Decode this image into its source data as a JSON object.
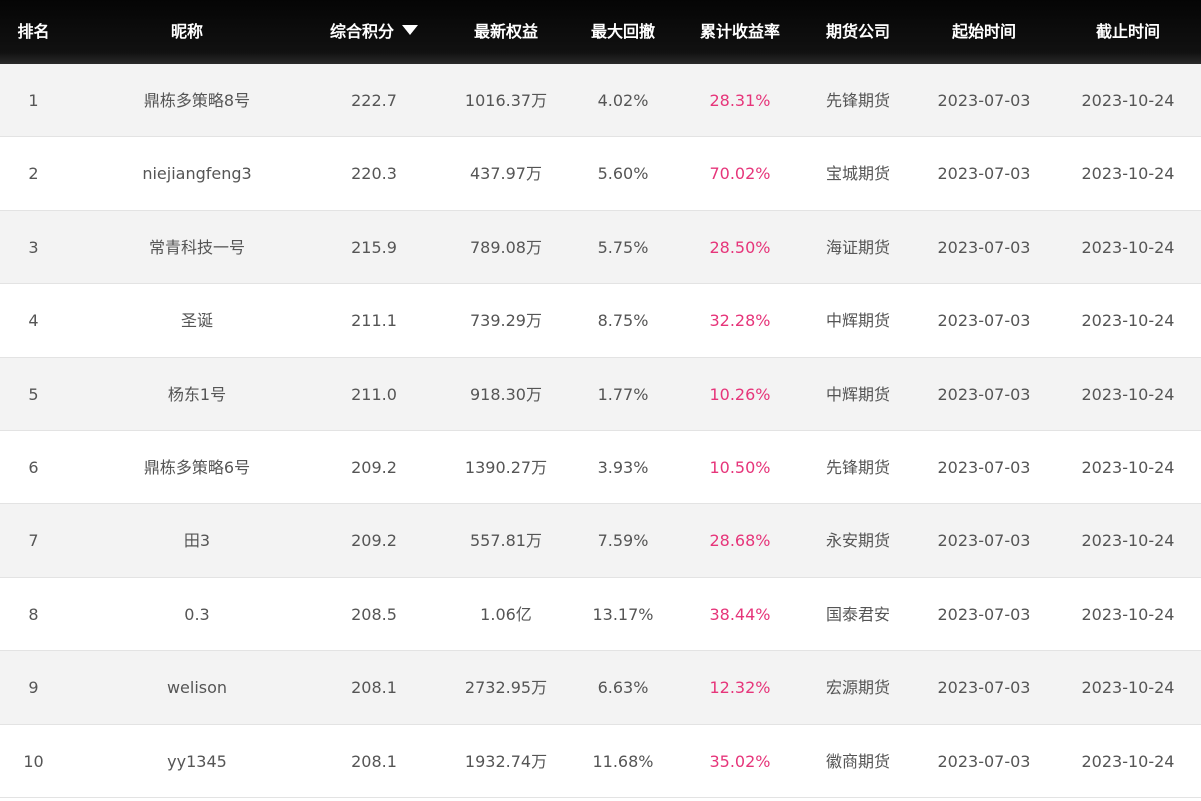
{
  "columns": {
    "rank": "排名",
    "name": "昵称",
    "score": "综合积分",
    "equity": "最新权益",
    "drawdown": "最大回撤",
    "return": "累计收益率",
    "broker": "期货公司",
    "start": "起始时间",
    "end": "截止时间"
  },
  "sort": {
    "column": "score",
    "direction": "desc",
    "icon": "triangle-down-icon"
  },
  "colors": {
    "header_bg": "#111111",
    "return_text": "#e6357a",
    "row_alt": "#f3f3f3",
    "text": "#555555"
  },
  "rows": [
    {
      "rank": "1",
      "name": "鼎栋多策略8号",
      "score": "222.7",
      "equity": "1016.37万",
      "drawdown": "4.02%",
      "return": "28.31%",
      "broker": "先锋期货",
      "start": "2023-07-03",
      "end": "2023-10-24"
    },
    {
      "rank": "2",
      "name": "niejiangfeng3",
      "score": "220.3",
      "equity": "437.97万",
      "drawdown": "5.60%",
      "return": "70.02%",
      "broker": "宝城期货",
      "start": "2023-07-03",
      "end": "2023-10-24"
    },
    {
      "rank": "3",
      "name": "常青科技一号",
      "score": "215.9",
      "equity": "789.08万",
      "drawdown": "5.75%",
      "return": "28.50%",
      "broker": "海证期货",
      "start": "2023-07-03",
      "end": "2023-10-24"
    },
    {
      "rank": "4",
      "name": "圣诞",
      "score": "211.1",
      "equity": "739.29万",
      "drawdown": "8.75%",
      "return": "32.28%",
      "broker": "中辉期货",
      "start": "2023-07-03",
      "end": "2023-10-24"
    },
    {
      "rank": "5",
      "name": "杨东1号",
      "score": "211.0",
      "equity": "918.30万",
      "drawdown": "1.77%",
      "return": "10.26%",
      "broker": "中辉期货",
      "start": "2023-07-03",
      "end": "2023-10-24"
    },
    {
      "rank": "6",
      "name": "鼎栋多策略6号",
      "score": "209.2",
      "equity": "1390.27万",
      "drawdown": "3.93%",
      "return": "10.50%",
      "broker": "先锋期货",
      "start": "2023-07-03",
      "end": "2023-10-24"
    },
    {
      "rank": "7",
      "name": "田3",
      "score": "209.2",
      "equity": "557.81万",
      "drawdown": "7.59%",
      "return": "28.68%",
      "broker": "永安期货",
      "start": "2023-07-03",
      "end": "2023-10-24"
    },
    {
      "rank": "8",
      "name": "0.3",
      "score": "208.5",
      "equity": "1.06亿",
      "drawdown": "13.17%",
      "return": "38.44%",
      "broker": "国泰君安",
      "start": "2023-07-03",
      "end": "2023-10-24"
    },
    {
      "rank": "9",
      "name": "welison",
      "score": "208.1",
      "equity": "2732.95万",
      "drawdown": "6.63%",
      "return": "12.32%",
      "broker": "宏源期货",
      "start": "2023-07-03",
      "end": "2023-10-24"
    },
    {
      "rank": "10",
      "name": "yy1345",
      "score": "208.1",
      "equity": "1932.74万",
      "drawdown": "11.68%",
      "return": "35.02%",
      "broker": "徽商期货",
      "start": "2023-07-03",
      "end": "2023-10-24"
    }
  ]
}
